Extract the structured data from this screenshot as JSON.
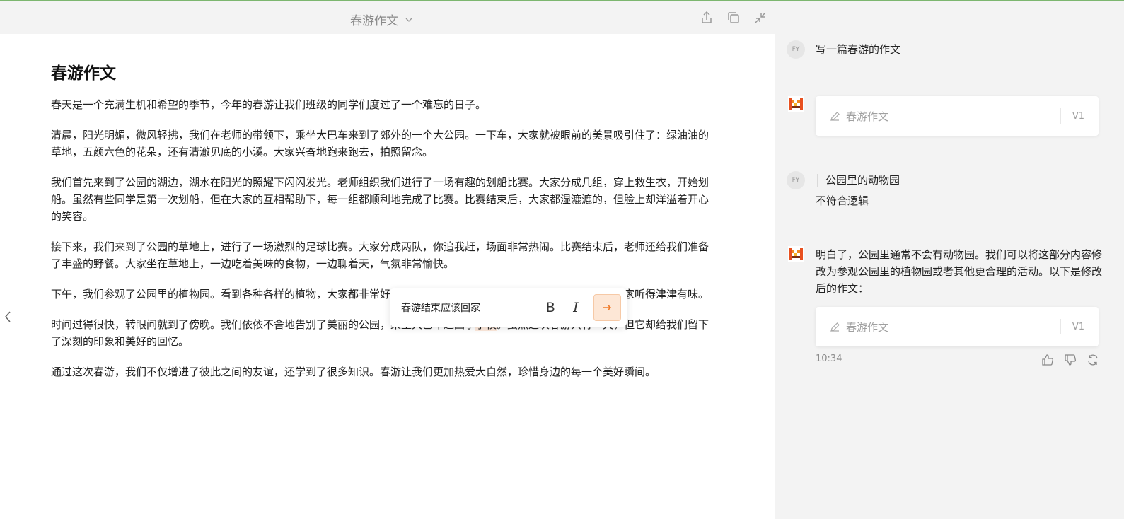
{
  "header": {
    "doc_title": "春游作文",
    "icons": [
      "chevron-down-icon",
      "share-icon",
      "copy-icon",
      "collapse-icon"
    ]
  },
  "document": {
    "heading": "春游作文",
    "paragraphs": [
      "春天是一个充满生机和希望的季节，今年的春游让我们班级的同学们度过了一个难忘的日子。",
      "清晨，阳光明媚，微风轻拂，我们在老师的带领下，乘坐大巴车来到了郊外的一个大公园。一下车，大家就被眼前的美景吸引住了：绿油油的草地，五颜六色的花朵，还有清澈见底的小溪。大家兴奋地跑来跑去，拍照留念。",
      "我们首先来到了公园的湖边，湖水在阳光的照耀下闪闪发光。老师组织我们进行了一场有趣的划船比赛。大家分成几组，穿上救生衣，开始划船。虽然有些同学是第一次划船，但在大家的互相帮助下，每一组都顺利地完成了比赛。比赛结束后，大家都湿漉漉的，但脸上却洋溢着开心的笑容。",
      "接下来，我们来到了公园的草地上，进行了一场激烈的足球比赛。大家分成两队，你追我赶，场面非常热闹。比赛结束后，老师还给我们准备了丰盛的野餐。大家坐在草地上，一边吃着美味的食物，一边聊着天，气氛非常愉快。",
      "下午，我们参观了公园里的植物园。看到各种各样的植物，大家都非常好奇，纷纷询问它们的名字、原产地和生长习性，大家听得津津有味。"
    ],
    "p6_before": "时间过得很快，转眼间就到了傍晚。我们依依不舍地告别了美丽的公园，乘坐大巴车返回了",
    "p6_highlight": "学校",
    "p6_after": "。虽然这次春游只有一天，但它却给我们留下了深刻的印象和美好的回忆。",
    "p7": "通过这次春游，我们不仅增进了彼此之间的友谊，还学到了很多知识。春游让我们更加热爱大自然，珍惜身边的每一个美好瞬间。"
  },
  "inline_edit": {
    "value": "春游结束应该回家",
    "bold_label": "B",
    "italic_label": "I"
  },
  "chat": {
    "user_avatar": "FY",
    "msg1": "写一篇春游的作文",
    "card1": {
      "title": "春游作文",
      "version": "V1"
    },
    "msg2_quote": "公园里的动物园",
    "msg2_text": "不符合逻辑",
    "reply": "明白了，公园里通常不会有动物园。我们可以将这部分内容修改为参观公园里的植物园或者其他更合理的活动。以下是修改后的作文：",
    "card2": {
      "title": "春游作文",
      "version": "V1"
    },
    "time": "10:34"
  },
  "colors": {
    "accent": "#f07b2a",
    "highlight": "#fde9dc",
    "top_line": "#7cb66f"
  }
}
